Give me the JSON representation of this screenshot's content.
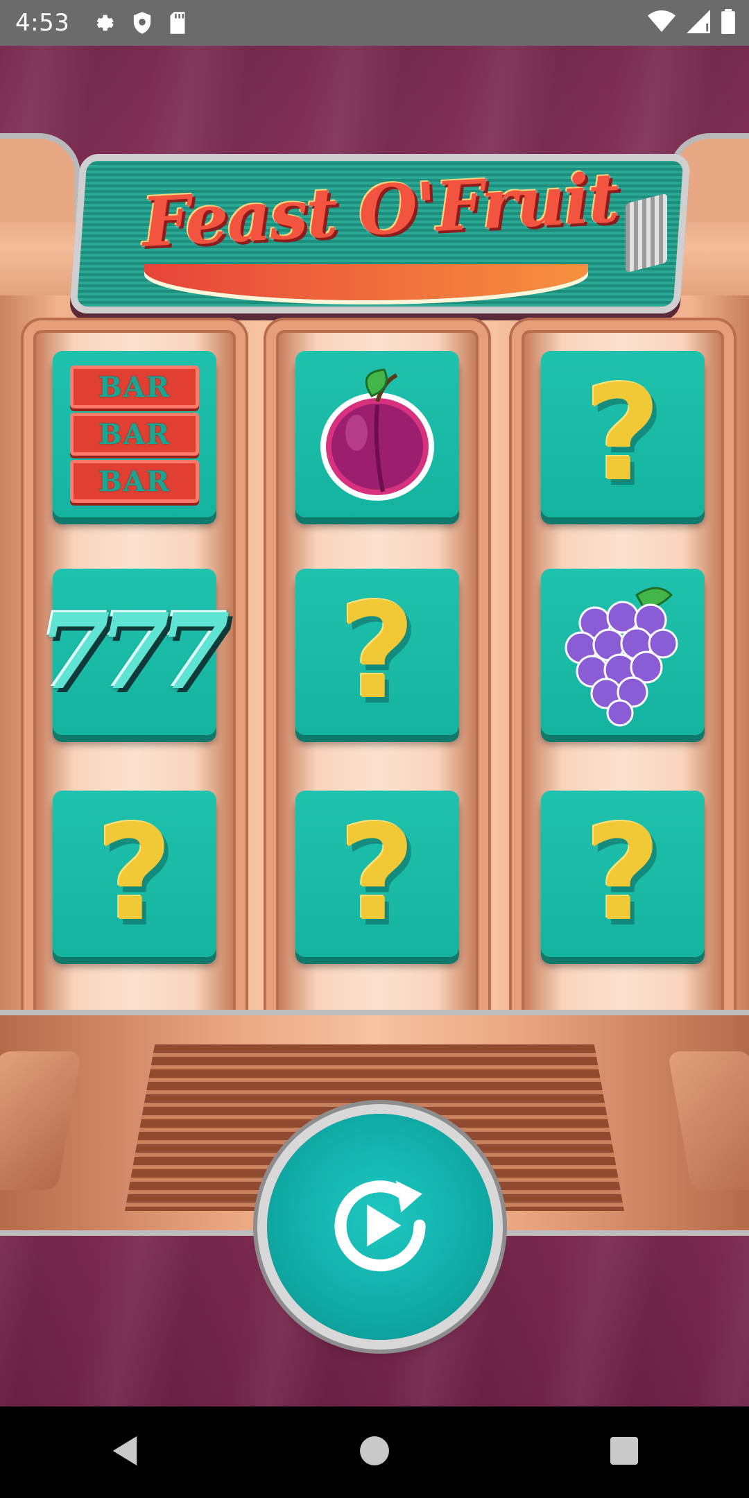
{
  "status_bar": {
    "time": "4:53",
    "icons": [
      "gear-icon",
      "shield-icon",
      "sd-card-icon",
      "wifi-icon",
      "cell-signal-icon",
      "battery-icon"
    ]
  },
  "game": {
    "title": "Feast O'Fruit",
    "reels": [
      {
        "symbols": [
          "bar-bar-bar",
          "triple-seven",
          "question-mark"
        ]
      },
      {
        "symbols": [
          "plum",
          "question-mark",
          "question-mark"
        ]
      },
      {
        "symbols": [
          "question-mark",
          "grapes",
          "question-mark"
        ]
      }
    ],
    "bar_label": "BAR",
    "seven_label": "777",
    "question_label": "?",
    "spin_button": "spin-replay-icon"
  },
  "nav_bar": {
    "icons": [
      "back-icon",
      "home-icon",
      "recents-icon"
    ]
  },
  "colors": {
    "tile": "#14b3a0",
    "question_mark": "#f1c836",
    "background": "#8a3358",
    "cabinet": "#f2b38e"
  }
}
